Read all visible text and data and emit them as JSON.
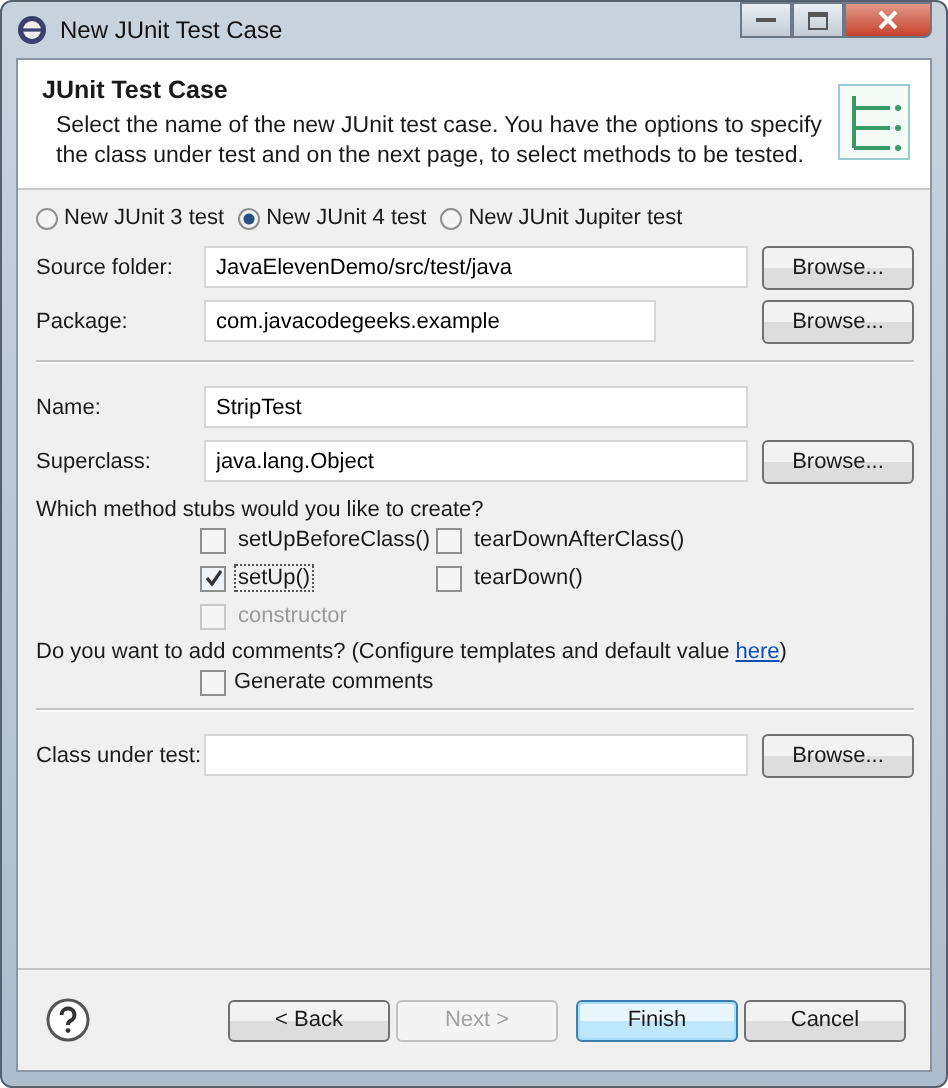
{
  "window": {
    "title": "New JUnit Test Case"
  },
  "header": {
    "title": "JUnit Test Case",
    "description": "Select the name of the new JUnit test case. You have the options to specify the class under test and on the next page, to select methods to be tested."
  },
  "junit_versions": [
    {
      "label": "New JUnit 3 test",
      "selected": false
    },
    {
      "label": "New JUnit 4 test",
      "selected": true
    },
    {
      "label": "New JUnit Jupiter test",
      "selected": false
    }
  ],
  "location_fields": [
    {
      "label": "Source folder:",
      "value": "JavaElevenDemo/src/test/java",
      "browse": "Browse..."
    },
    {
      "label": "Package:",
      "value": "com.javacodegeeks.example",
      "browse": "Browse..."
    }
  ],
  "class_fields": [
    {
      "label": "Name:",
      "value": "StripTest"
    },
    {
      "label": "Superclass:",
      "value": "java.lang.Object",
      "browse": "Browse..."
    }
  ],
  "stubs": {
    "question": "Which method stubs would you like to create?",
    "items": [
      {
        "label": "setUpBeforeClass()",
        "checked": false,
        "disabled": false,
        "focused": false
      },
      {
        "label": "tearDownAfterClass()",
        "checked": false,
        "disabled": false,
        "focused": false
      },
      {
        "label": "setUp()",
        "checked": true,
        "disabled": false,
        "focused": true
      },
      {
        "label": "tearDown()",
        "checked": false,
        "disabled": false,
        "focused": false
      },
      {
        "label": "constructor",
        "checked": false,
        "disabled": true,
        "focused": false
      }
    ]
  },
  "comments": {
    "question": "Do you want to add comments? (Configure templates and default value",
    "link": "here",
    "after": ")",
    "option": {
      "label": "Generate comments",
      "checked": false
    }
  },
  "class_under_test": {
    "label": "Class under test:",
    "browse": "Browse..."
  },
  "buttons": [
    {
      "label": "< Back",
      "disabled": false,
      "default": false
    },
    {
      "label": "Next >",
      "disabled": true,
      "default": false
    },
    {
      "label": "Finish",
      "disabled": false,
      "default": true
    },
    {
      "label": "Cancel",
      "disabled": false,
      "default": false
    }
  ]
}
